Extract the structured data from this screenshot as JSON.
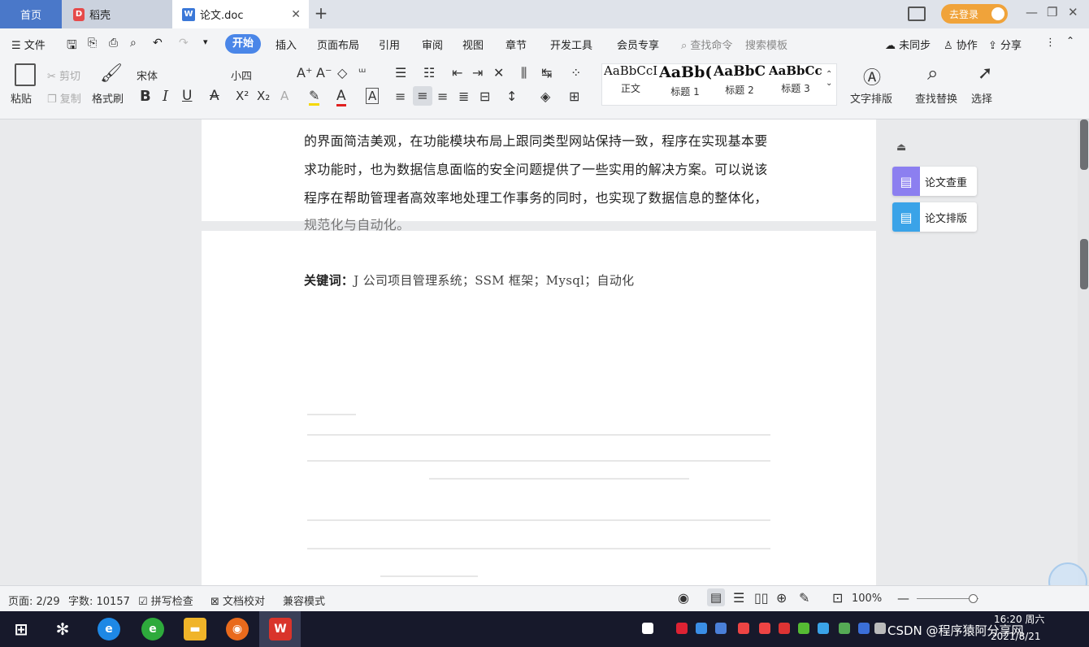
{
  "tabs": {
    "home": "首页",
    "daoke": "稻壳",
    "doc": "论文.doc",
    "close": "✕",
    "new_tab": "+"
  },
  "login": "去登录",
  "window": {
    "minimize": "—",
    "restore": "❐",
    "close": "✕"
  },
  "menubar": {
    "file": "文件",
    "items": [
      "开始",
      "插入",
      "页面布局",
      "引用",
      "审阅",
      "视图",
      "章节",
      "开发工具",
      "会员专享"
    ],
    "search_cmd": "查找命令",
    "search_template": "搜索模板",
    "sync": "未同步",
    "collab": "协作",
    "share": "分享"
  },
  "ribbon": {
    "paste": "粘贴",
    "cut": "剪切",
    "copy": "复制",
    "format_painter": "格式刷",
    "font": "宋体",
    "size": "小四",
    "styles": [
      {
        "sample": "AaBbCcI",
        "name": "正文"
      },
      {
        "sample": "AaBb(",
        "name": "标题 1"
      },
      {
        "sample": "AaBbC",
        "name": "标题 2"
      },
      {
        "sample": "AaBbCcl",
        "name": "标题 3"
      }
    ],
    "text_layout": "文字排版",
    "find_replace": "查找替换",
    "select": "选择"
  },
  "document": {
    "lines": [
      "的界面简洁美观，在功能模块布局上跟同类型网站保持一致，程序在实现基本要",
      "求功能时，也为数据信息面临的安全问题提供了一些实用的解决方案。可以说该",
      "程序在帮助管理者高效率地处理工作事务的同时，也实现了数据信息的整体化，",
      "规范化与自动化。"
    ],
    "keywords_label": "关键词：",
    "keywords": "J 公司项目管理系统；SSM 框架；Mysql；自动化"
  },
  "side_panel": {
    "check": "论文查重",
    "layout": "论文排版"
  },
  "status": {
    "page": "页面: 2/29",
    "words": "字数: 10157",
    "spell": "拼写检查",
    "proof": "文档校对",
    "compat": "兼容模式",
    "zoom": "100%"
  },
  "taskbar": {
    "time": "16:20 周六",
    "date": "2021/8/21",
    "watermark": "CSDN @程序猿阿分享网"
  }
}
